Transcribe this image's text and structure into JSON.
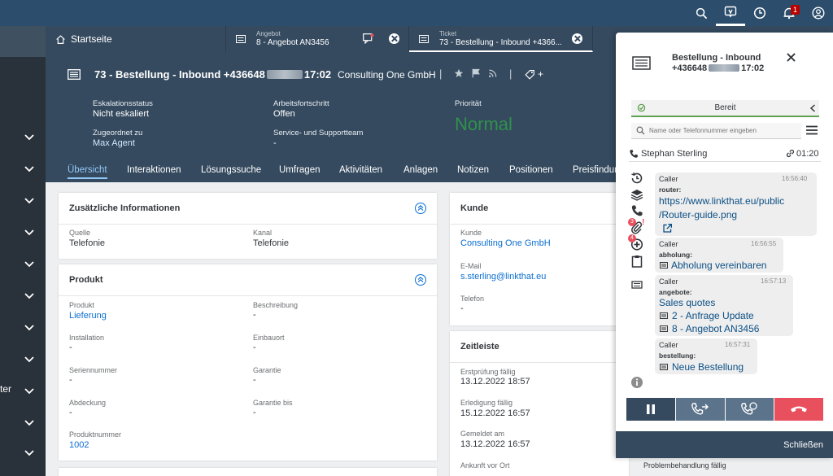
{
  "shell": {
    "notification_count": "1"
  },
  "sidebar": {
    "partial_text": "ter"
  },
  "tabs": {
    "home_label": "Startseite",
    "tab1": {
      "type": "Angebot",
      "title": "8 - Angebot AN3456"
    },
    "tab2": {
      "type": "Ticket",
      "title": "73 - Bestellung - Inbound +4366..."
    }
  },
  "header": {
    "title_prefix": "73 - Bestellung - Inbound +436648",
    "title_suffix": "17:02",
    "company": "Consulting One GmbH",
    "add_label": "+",
    "attributes": {
      "eskalation_label": "Eskalationsstatus",
      "eskalation_value": "Nicht eskaliert",
      "arbeits_label": "Arbeitsfortschritt",
      "arbeits_value": "Offen",
      "prio_label": "Priorität",
      "prio_value": "Normal",
      "zugeordnet_label": "Zugeordnet zu",
      "zugeordnet_value": "Max Agent",
      "service_label": "Service- und Supportteam",
      "service_value": "-"
    }
  },
  "nav": [
    "Übersicht",
    "Interaktionen",
    "Lösungssuche",
    "Umfragen",
    "Aktivitäten",
    "Anlagen",
    "Notizen",
    "Positionen",
    "Preisfindun"
  ],
  "cards": {
    "info": {
      "title": "Zusätzliche Informationen",
      "quelle_label": "Quelle",
      "quelle_value": "Telefonie",
      "kanal_label": "Kanal",
      "kanal_value": "Telefonie"
    },
    "produkt": {
      "title": "Produkt",
      "produkt_label": "Produkt",
      "produkt_value": "Lieferung",
      "beschreibung_label": "Beschreibung",
      "beschreibung_value": "-",
      "installation_label": "Installation",
      "installation_value": "-",
      "einbauort_label": "Einbauort",
      "einbauort_value": "-",
      "serien_label": "Seriennummer",
      "serien_value": "-",
      "garantie_label": "Garantie",
      "garantie_value": "-",
      "abdeckung_label": "Abdeckung",
      "abdeckung_value": "-",
      "garantiebis_label": "Garantie bis",
      "garantiebis_value": "-",
      "nummer_label": "Produktnummer",
      "nummer_value": "1002"
    },
    "kunde": {
      "title": "Kunde",
      "kunde_label": "Kunde",
      "kunde_value": "Consulting One GmbH",
      "email_label": "E-Mail",
      "email_value": "s.sterling@linkthat.eu",
      "telefon_label": "Telefon",
      "telefon_value": "-"
    },
    "zeitleiste": {
      "title": "Zeitleiste",
      "erst_label": "Erstprüfung fällig",
      "erst_value": "13.12.2022 18:57",
      "erl_label": "Erledigung fällig",
      "erl_value": "15.12.2022 16:57",
      "gem_label": "Gemeldet am",
      "gem_value": "13.12.2022 16:57",
      "ank_label": "Ankunft vor Ort"
    },
    "bottom_label": "Problembehandlung fällig"
  },
  "panel": {
    "title_line1": "Bestellung - Inbound",
    "title_line2_prefix": "+436648",
    "title_line2_suffix": "17:02",
    "status": "Bereit",
    "search_placeholder": "Name oder Telefonnummer eingeben",
    "caller_name": "Stephan Sterling",
    "call_time": "01:20",
    "badge_3": "3",
    "badge_4": "4",
    "messages": [
      {
        "who": "Caller",
        "time": "16:56:40",
        "key": "router:",
        "line1": "https://www.linkthat.eu/public",
        "line2": "/Router-guide.png"
      },
      {
        "who": "Caller",
        "time": "16:56:55",
        "key": "abholung:",
        "line1": "Abholung vereinbaren"
      },
      {
        "who": "Caller",
        "time": "16:57:13",
        "key": "angebote:",
        "line1": "Sales quotes",
        "line2": "2 - Anfrage Update",
        "line3": "8 - Angebot AN3456"
      },
      {
        "who": "Caller",
        "time": "16:57:31",
        "key": "bestellung:",
        "line1": "Neue Bestellung"
      }
    ],
    "close_label": "Schließen"
  },
  "colors": {
    "shell": "#2c4e6c",
    "header": "#354a5f",
    "accent": "#0a6ed1",
    "normal": "#30914c",
    "hangup": "#e9505e"
  }
}
